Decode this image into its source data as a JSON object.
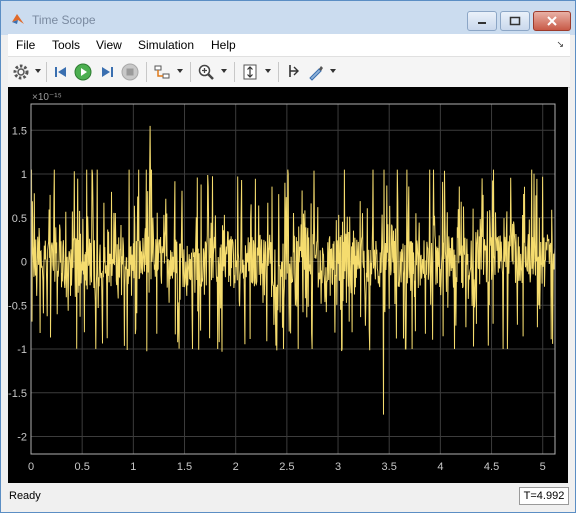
{
  "window": {
    "title": "Time Scope",
    "controls": [
      "minimize",
      "maximize",
      "close"
    ]
  },
  "menu": {
    "items": [
      "File",
      "Tools",
      "View",
      "Simulation",
      "Help"
    ]
  },
  "toolbar": {
    "icons": [
      "gear-icon",
      "step-back-icon",
      "run-icon",
      "step-forward-icon",
      "stop-icon",
      "signal-selector-icon",
      "zoom-in-icon",
      "scale-axes-icon",
      "cursor-icon",
      "style-icon"
    ]
  },
  "plot": {
    "exponent_label": "×10⁻¹⁵",
    "trace_color": "#f5dc6e",
    "background_color": "#000000",
    "grid": true
  },
  "chart_data": {
    "type": "line",
    "title": "",
    "xlabel": "",
    "ylabel": "",
    "exponent": -15,
    "xlim": [
      0,
      5.12
    ],
    "ylim": [
      -2.2,
      1.8
    ],
    "x_ticks": [
      "0",
      "0.5",
      "1",
      "1.5",
      "2",
      "2.5",
      "3",
      "3.5",
      "4",
      "4.5",
      "5"
    ],
    "x_tick_values": [
      0,
      0.5,
      1,
      1.5,
      2,
      2.5,
      3,
      3.5,
      4,
      4.5,
      5
    ],
    "y_ticks": [
      "1.5",
      "1",
      "0.5",
      "0",
      "-0.5",
      "-1",
      "-1.5",
      "-2"
    ],
    "y_tick_values": [
      1.5,
      1,
      0.5,
      0,
      -0.5,
      -1,
      -1.5,
      -2
    ],
    "series": [
      {
        "style": "dense noise centered at 0, core band approx -0.3 to 0.3, frequent spikes to ±1, peaks near 1.55 and -1.75",
        "x_range": [
          0,
          5.12
        ],
        "band": [
          -0.3,
          0.3
        ],
        "typical_extent": [
          -1.0,
          1.05
        ],
        "max": 1.55,
        "min": -1.75
      }
    ]
  },
  "status": {
    "text": "Ready",
    "time": "T=4.992"
  }
}
